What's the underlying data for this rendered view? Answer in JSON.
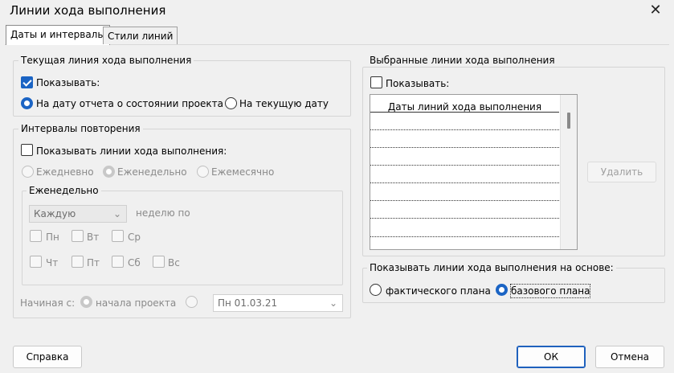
{
  "window": {
    "title": "Линии хода выполнения"
  },
  "tabs": [
    {
      "label": "Даты и интервалы"
    },
    {
      "label": "Стили линий"
    }
  ],
  "current_line": {
    "group_label": "Текущая линия хода выполнения",
    "show_label": "Показывать:",
    "option_status_date": "На дату отчета о состоянии проекта",
    "option_current_date": "На текущую дату"
  },
  "recurring": {
    "group_label": "Интервалы повторения",
    "show_label": "Показывать линии хода выполнения:",
    "daily": "Ежедневно",
    "weekly": "Еженедельно",
    "monthly": "Ежемесячно",
    "weekly_group_label": "Еженедельно",
    "every_value": "Каждую",
    "week_on_label": "неделю по",
    "days": [
      "Пн",
      "Вт",
      "Ср",
      "Чт",
      "Пт",
      "Сб",
      "Вс"
    ],
    "start_label": "Начиная с:",
    "start_project": "начала проекта",
    "start_date": "Пн 01.03.21"
  },
  "selected_lines": {
    "group_label": "Выбранные линии хода выполнения",
    "show_label": "Показывать:",
    "column_header": "Даты линий хода выполнения",
    "delete_button": "Удалить"
  },
  "basis": {
    "group_label": "Показывать линии хода выполнения на основе:",
    "actual": "фактического плана",
    "baseline": "базового плана"
  },
  "buttons": {
    "help": "Справка",
    "ok": "ОК",
    "cancel": "Отмена"
  }
}
